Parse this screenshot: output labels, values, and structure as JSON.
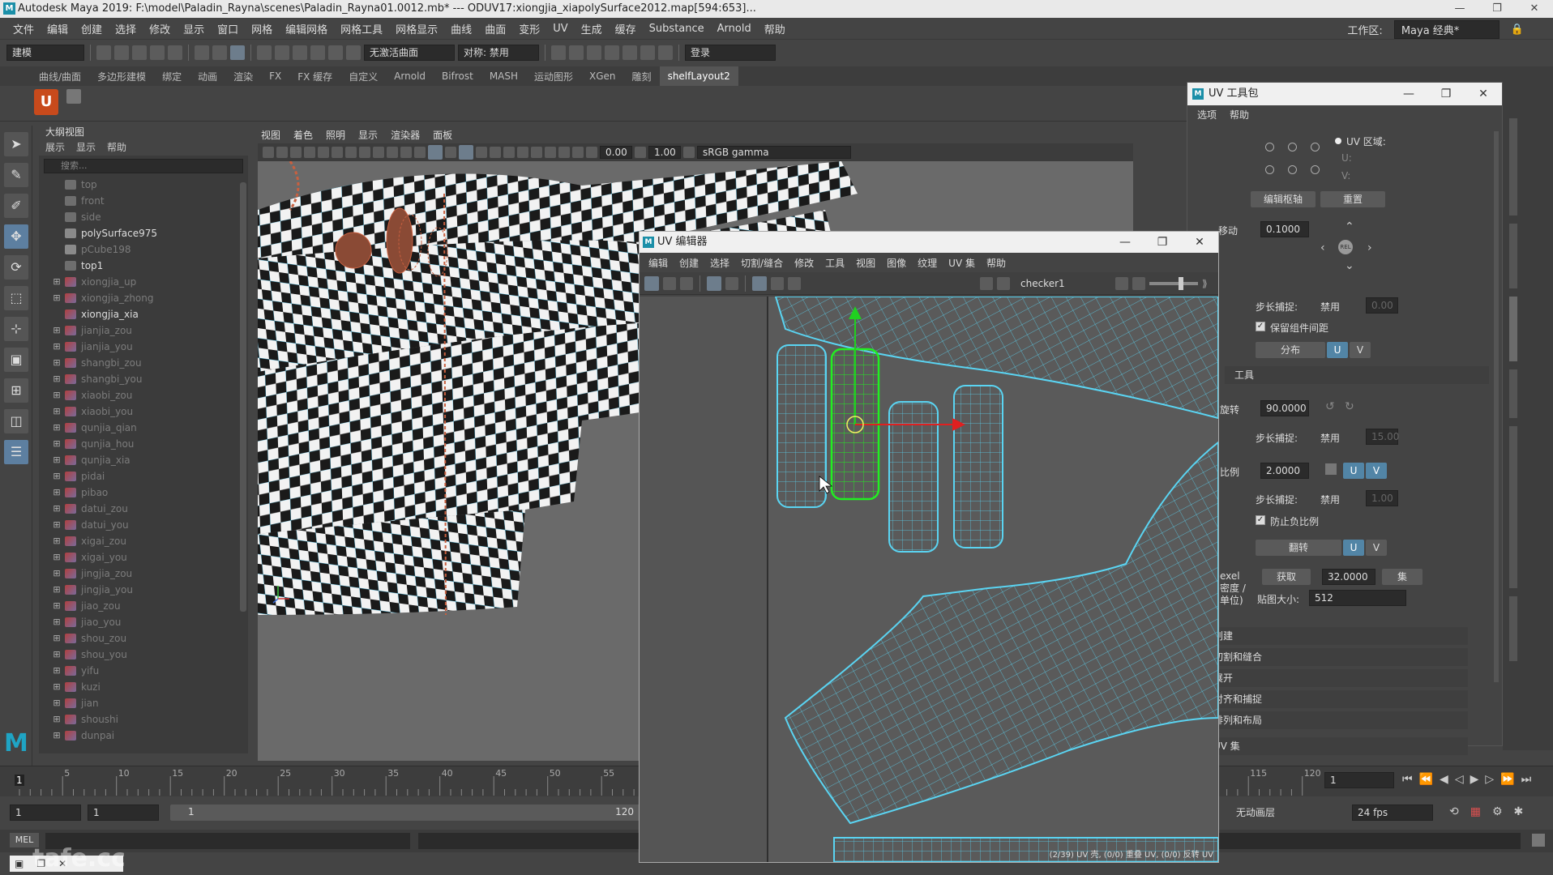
{
  "window": {
    "title": "Autodesk Maya 2019: F:\\model\\Paladin_Rayna\\scenes\\Paladin_Rayna01.0012.mb*   ---   ODUV17:xiongjia_xiapolySurface2012.map[594:653]...",
    "logo": "M",
    "controls": [
      "—",
      "❐",
      "✕"
    ]
  },
  "menubar": {
    "items": [
      "文件",
      "编辑",
      "创建",
      "选择",
      "修改",
      "显示",
      "窗口",
      "网格",
      "编辑网格",
      "网格工具",
      "网格显示",
      "曲线",
      "曲面",
      "变形",
      "UV",
      "生成",
      "缓存",
      "Substance",
      "Arnold",
      "帮助"
    ],
    "workspace_label": "工作区:",
    "workspace_value": "Maya 经典*"
  },
  "statusline": {
    "mode": "建模",
    "surface": "无激活曲面",
    "symmetry": "对称: 禁用",
    "login": "登录"
  },
  "shelf": {
    "tabs": [
      "曲线/曲面",
      "多边形建模",
      "绑定",
      "动画",
      "渲染",
      "FX",
      "FX 缓存",
      "自定义",
      "Arnold",
      "Bifrost",
      "MASH",
      "运动图形",
      "XGen",
      "雕刻",
      "shelfLayout2"
    ],
    "active": "shelfLayout2"
  },
  "outliner": {
    "title": "大纲视图",
    "menu": [
      "展示",
      "显示",
      "帮助"
    ],
    "search_placeholder": "搜索...",
    "items": [
      {
        "label": "top",
        "type": "cam",
        "dim": true,
        "expand": false
      },
      {
        "label": "front",
        "type": "cam",
        "dim": true,
        "expand": false
      },
      {
        "label": "side",
        "type": "cam",
        "dim": true,
        "expand": false
      },
      {
        "label": "polySurface975",
        "type": "node",
        "dim": false,
        "expand": false
      },
      {
        "label": "pCube198",
        "type": "node",
        "dim": true,
        "expand": false
      },
      {
        "label": "top1",
        "type": "cam",
        "dim": false,
        "expand": false
      },
      {
        "label": "xiongjia_up",
        "type": "mesh",
        "dim": true,
        "expand": true
      },
      {
        "label": "xiongjia_zhong",
        "type": "mesh",
        "dim": true,
        "expand": true
      },
      {
        "label": "xiongjia_xia",
        "type": "mesh",
        "dim": false,
        "expand": false
      },
      {
        "label": "jianjia_zou",
        "type": "mesh",
        "dim": true,
        "expand": true
      },
      {
        "label": "jianjia_you",
        "type": "mesh",
        "dim": true,
        "expand": true
      },
      {
        "label": "shangbi_zou",
        "type": "mesh",
        "dim": true,
        "expand": true
      },
      {
        "label": "shangbi_you",
        "type": "mesh",
        "dim": true,
        "expand": true
      },
      {
        "label": "xiaobi_zou",
        "type": "mesh",
        "dim": true,
        "expand": true
      },
      {
        "label": "xiaobi_you",
        "type": "mesh",
        "dim": true,
        "expand": true
      },
      {
        "label": "qunjia_qian",
        "type": "mesh",
        "dim": true,
        "expand": true
      },
      {
        "label": "qunjia_hou",
        "type": "mesh",
        "dim": true,
        "expand": true
      },
      {
        "label": "qunjia_xia",
        "type": "mesh",
        "dim": true,
        "expand": true
      },
      {
        "label": "pidai",
        "type": "mesh",
        "dim": true,
        "expand": true
      },
      {
        "label": "pibao",
        "type": "mesh",
        "dim": true,
        "expand": true
      },
      {
        "label": "datui_zou",
        "type": "mesh",
        "dim": true,
        "expand": true
      },
      {
        "label": "datui_you",
        "type": "mesh",
        "dim": true,
        "expand": true
      },
      {
        "label": "xigai_zou",
        "type": "mesh",
        "dim": true,
        "expand": true
      },
      {
        "label": "xigai_you",
        "type": "mesh",
        "dim": true,
        "expand": true
      },
      {
        "label": "jingjia_zou",
        "type": "mesh",
        "dim": true,
        "expand": true
      },
      {
        "label": "jingjia_you",
        "type": "mesh",
        "dim": true,
        "expand": true
      },
      {
        "label": "jiao_zou",
        "type": "mesh",
        "dim": true,
        "expand": true
      },
      {
        "label": "jiao_you",
        "type": "mesh",
        "dim": true,
        "expand": true
      },
      {
        "label": "shou_zou",
        "type": "mesh",
        "dim": true,
        "expand": true
      },
      {
        "label": "shou_you",
        "type": "mesh",
        "dim": true,
        "expand": true
      },
      {
        "label": "yifu",
        "type": "mesh",
        "dim": true,
        "expand": true
      },
      {
        "label": "kuzi",
        "type": "mesh",
        "dim": true,
        "expand": true
      },
      {
        "label": "jian",
        "type": "mesh",
        "dim": true,
        "expand": true
      },
      {
        "label": "shoushi",
        "type": "mesh",
        "dim": true,
        "expand": true
      },
      {
        "label": "dunpai",
        "type": "mesh",
        "dim": true,
        "expand": true
      }
    ]
  },
  "viewport": {
    "menu": [
      "视图",
      "着色",
      "照明",
      "显示",
      "渲染器",
      "面板"
    ],
    "field_a": "0.00",
    "field_b": "1.00",
    "colorspace": "sRGB gamma"
  },
  "uv_editor": {
    "title": "UV 编辑器",
    "menu": [
      "编辑",
      "创建",
      "选择",
      "切割/缝合",
      "修改",
      "工具",
      "视图",
      "图像",
      "纹理",
      "UV 集",
      "帮助"
    ],
    "texture": "checker1",
    "status": "(2/39) UV 壳, (0/0) 重叠 UV, (0/0) 反转 UV"
  },
  "uv_toolkit": {
    "title": "UV 工具包",
    "menu": [
      "选项",
      "帮助"
    ],
    "uv_region": "UV 区域:",
    "u_label": "U:",
    "v_label": "V:",
    "edit_pivot": "编辑枢轴",
    "reset": "重置",
    "move_label": "移动",
    "move_value": "0.1000",
    "step_snap": "步长捕捉:",
    "disabled": "禁用",
    "step_move_value": "0.00",
    "preserve_spacing": "保留组件间距",
    "distribute": "分布",
    "u": "U",
    "v": "V",
    "tools_section": "工具",
    "rotate_label": "旋转",
    "rotate_value": "90.0000",
    "step_rotate_value": "15.00",
    "scale_label": "比例",
    "scale_value": "2.0000",
    "step_scale_value": "1.00",
    "prevent_negative": "防止负比例",
    "flip": "翻转",
    "texel_label": "exel 密度 /单位)",
    "get": "获取",
    "texel_value": "32.0000",
    "set": "集",
    "map_size_label": "贴图大小:",
    "map_size": "512",
    "sections": [
      "创建",
      "切割和缝合",
      "展开",
      "对齐和捕捉",
      "排列和布局",
      "UV 集"
    ]
  },
  "timeline": {
    "ticks": [
      "5",
      "10",
      "15",
      "20",
      "25",
      "30",
      "35",
      "40",
      "45",
      "50",
      "55",
      "115",
      "120"
    ],
    "current": "1",
    "current_field": "1"
  },
  "range": {
    "start": "1",
    "start2": "1",
    "inner_start": "1",
    "inner_end": "120",
    "anim_layer": "无动画层",
    "fps": "24 fps"
  },
  "cmdline": {
    "lang": "MEL"
  },
  "watermark": "tafe.cc",
  "colors": {
    "accent_blue": "#5285a6",
    "uv_wire": "#5ad4f2",
    "uv_selected": "#22ee22",
    "gizmo_red": "#e02020",
    "gizmo_green": "#20d020"
  }
}
